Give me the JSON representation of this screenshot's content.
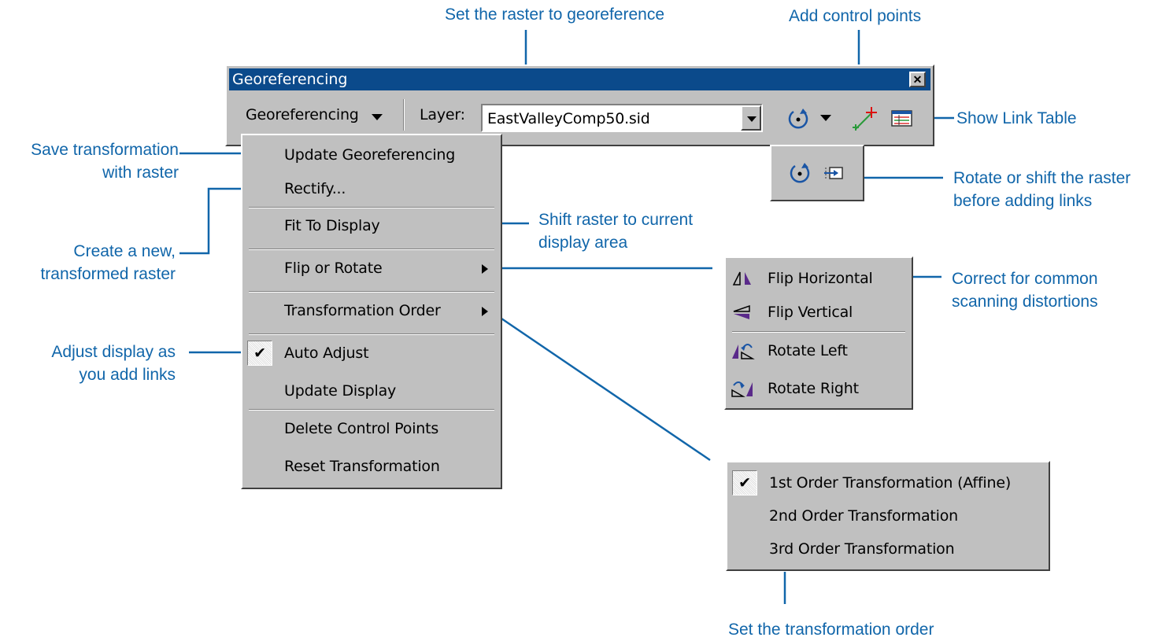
{
  "window": {
    "title": "Georeferencing",
    "close_label": "✕"
  },
  "toolbar": {
    "menu_label": "Georeferencing",
    "layer_label": "Layer:",
    "layer_value": "EastValleyComp50.sid"
  },
  "menu": {
    "items": [
      {
        "label": "Update Georeferencing"
      },
      {
        "label": "Rectify..."
      },
      {
        "label": "Fit To Display"
      },
      {
        "label": "Flip or Rotate"
      },
      {
        "label": "Transformation Order"
      },
      {
        "label": "Auto Adjust",
        "checked": true
      },
      {
        "label": "Update Display"
      },
      {
        "label": "Delete Control Points"
      },
      {
        "label": "Reset Transformation"
      }
    ]
  },
  "flip_menu": {
    "items": [
      {
        "label": "Flip Horizontal",
        "icon": "flip-horizontal-icon"
      },
      {
        "label": "Flip Vertical",
        "icon": "flip-vertical-icon"
      },
      {
        "label": "Rotate Left",
        "icon": "rotate-left-icon"
      },
      {
        "label": "Rotate Right",
        "icon": "rotate-right-icon"
      }
    ]
  },
  "order_menu": {
    "items": [
      {
        "label": "1st Order Transformation (Affine)",
        "checked": true
      },
      {
        "label": "2nd Order Transformation"
      },
      {
        "label": "3rd Order Transformation"
      }
    ]
  },
  "callouts": {
    "set_raster": "Set the raster to georeference",
    "add_points": "Add control points",
    "show_link_table": "Show Link Table",
    "save_transform_1": "Save transformation",
    "save_transform_2": "with raster",
    "create_new_1": "Create a new,",
    "create_new_2": "transformed raster",
    "shift_raster_1": "Shift raster to current",
    "shift_raster_2": "display area",
    "rotate_shift_1": "Rotate or shift the raster",
    "rotate_shift_2": "before adding links",
    "correct_1": "Correct for common",
    "correct_2": "scanning distortions",
    "adjust_1": "Adjust display as",
    "adjust_2": "you add links",
    "set_order": "Set the transformation order"
  },
  "colors": {
    "accent": "#1166aa",
    "title_bar": "#0b4a8b",
    "face": "#c0c0c0"
  }
}
